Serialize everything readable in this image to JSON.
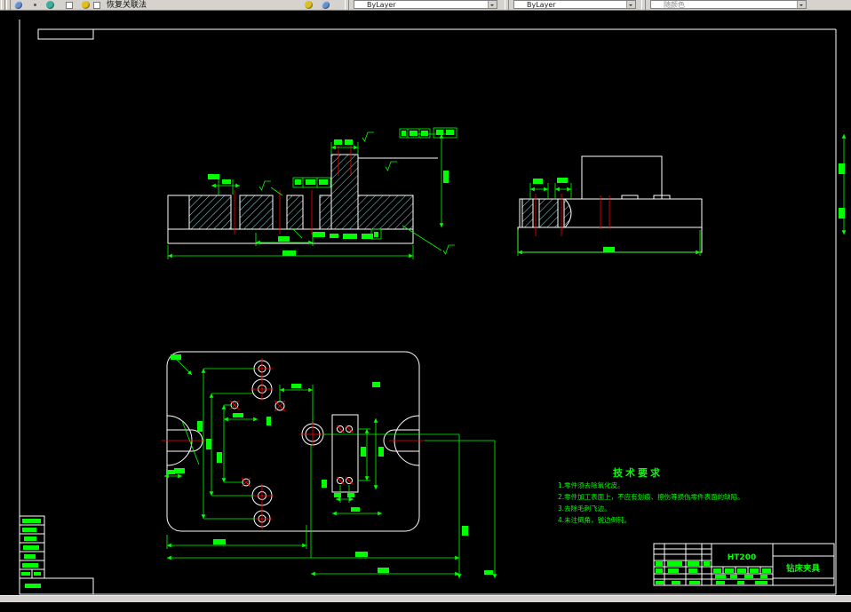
{
  "toolbar": {
    "mode_label": "恢复关联法",
    "color_control": "ByLayer",
    "linetype_control": "ByLayer",
    "plot_style_control": "随颜色"
  },
  "tech_requirements": {
    "title": "技术要求",
    "items": [
      "1.零件须去除氧化皮。",
      "2.零件加工表面上，不应有划痕、擦伤等损伤零件表面的缺陷。",
      "3.去除毛刺飞边。",
      "4.未注倒角，锐边倒钝。"
    ]
  },
  "title_block": {
    "material": "HT200",
    "part_name": "钻床夹具"
  },
  "colors": {
    "canvas_bg": "#000000",
    "outline": "#FFFFFF",
    "dimension": "#00FF00",
    "centerline": "#FF0000",
    "hatch": "#93D6D6",
    "toolbar_bg": "#D6D3CE"
  }
}
